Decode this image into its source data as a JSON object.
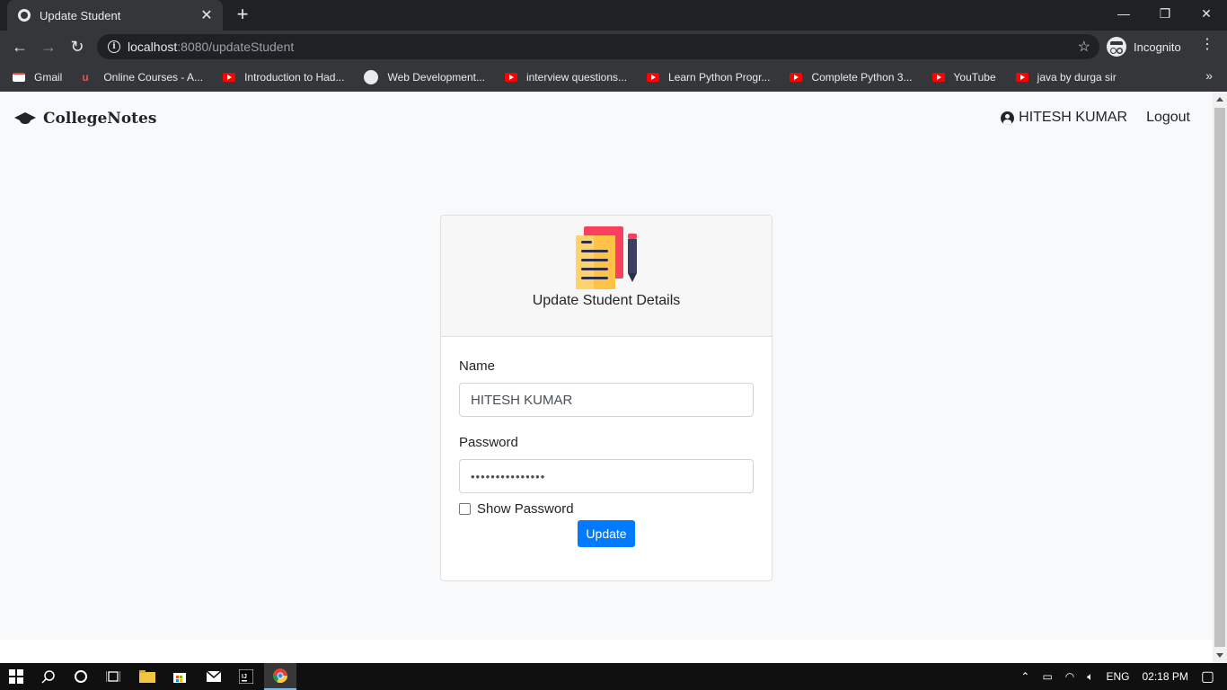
{
  "browser": {
    "tab_title": "Update Student",
    "tab_close": "✕",
    "new_tab": "+",
    "url_host": "localhost",
    "url_rest": ":8080/updateStudent",
    "incognito_label": "Incognito",
    "window_minimize": "—",
    "window_restore": "❐",
    "window_close": "✕",
    "back": "←",
    "forward": "→",
    "reload": "↻",
    "star": "☆",
    "menu": "⋮",
    "more_bookmarks": "»"
  },
  "bookmarks": [
    {
      "label": "Gmail",
      "icon": "gmail-icon"
    },
    {
      "label": "Online Courses - A...",
      "icon": "udemy-icon"
    },
    {
      "label": "Introduction to Had...",
      "icon": "youtube-icon"
    },
    {
      "label": "Web Development...",
      "icon": "web-icon"
    },
    {
      "label": "interview questions...",
      "icon": "youtube-icon"
    },
    {
      "label": "Learn Python Progr...",
      "icon": "youtube-icon"
    },
    {
      "label": "Complete Python 3...",
      "icon": "youtube-icon"
    },
    {
      "label": "YouTube",
      "icon": "youtube-icon"
    },
    {
      "label": "java by durga sir",
      "icon": "youtube-icon"
    }
  ],
  "navbar": {
    "brand": "CollegeNotes",
    "user_name": "HITESH KUMAR",
    "logout": "Logout"
  },
  "form": {
    "title": "Update Student Details",
    "name_label": "Name",
    "name_value": "HITESH KUMAR",
    "password_label": "Password",
    "password_value": "•••••••••••••••",
    "show_password_label": "Show Password",
    "submit_label": "Update"
  },
  "taskbar": {
    "language": "ENG",
    "time": "02:18 PM"
  },
  "colors": {
    "primary": "#007bff",
    "page_bg": "#f8f9fa",
    "chrome_dark": "#202124"
  }
}
